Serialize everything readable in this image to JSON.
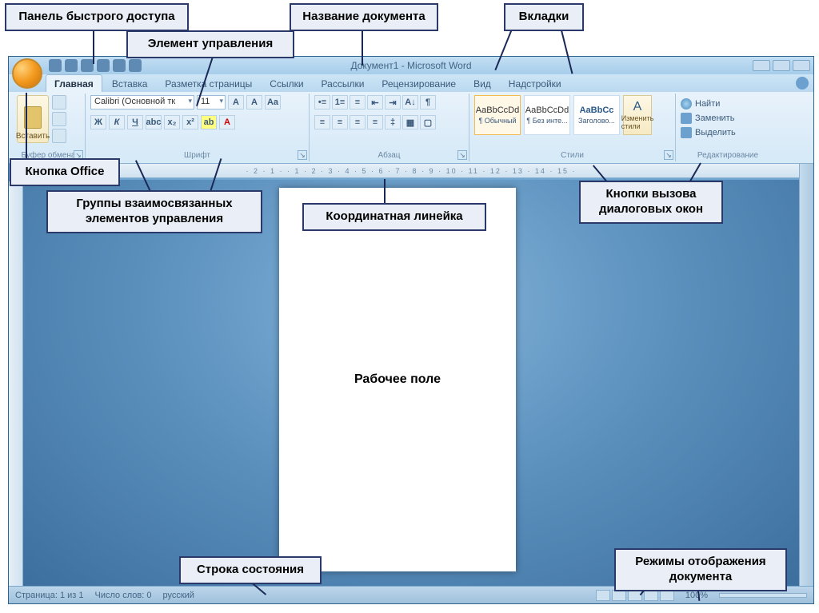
{
  "callouts": {
    "quick_access": "Панель быстрого доступа",
    "control_element": "Элемент управления",
    "document_title": "Название документа",
    "tabs": "Вкладки",
    "office_button": "Кнопка Office",
    "groups": "Группы взаимосвязанных элементов управления",
    "ruler": "Координатная линейка",
    "dialog_launchers": "Кнопки вызова диалоговых окон",
    "workspace": "Рабочее поле",
    "status_bar": "Строка состояния",
    "view_modes": "Режимы отображения документа"
  },
  "title": "Документ1 - Microsoft Word",
  "tabs_list": {
    "home": "Главная",
    "insert": "Вставка",
    "layout": "Разметка страницы",
    "refs": "Ссылки",
    "mail": "Рассылки",
    "review": "Рецензирование",
    "view": "Вид",
    "addins": "Надстройки"
  },
  "ribbon": {
    "clipboard": {
      "label": "Буфер обмена",
      "paste": "Вставить"
    },
    "font": {
      "label": "Шрифт",
      "font_name": "Calibri (Основной тк",
      "font_size": "11"
    },
    "paragraph": {
      "label": "Абзац"
    },
    "styles": {
      "label": "Стили",
      "preview": "AaBbCcDd",
      "preview_big": "AaBbCc",
      "normal": "¶ Обычный",
      "no_spacing": "¶ Без инте...",
      "heading1": "Заголово...",
      "change": "Изменить стили"
    },
    "editing": {
      "label": "Редактирование",
      "find": "Найти",
      "replace": "Заменить",
      "select": "Выделить"
    }
  },
  "ruler_text": "· 2 · 1 ·   · 1 · 2 · 3 · 4 · 5 · 6 · 7 · 8 · 9 · 10 · 11 · 12 · 13 · 14 · 15 ·",
  "status": {
    "page": "Страница: 1 из 1",
    "words": "Число слов: 0",
    "lang": "русский",
    "zoom": "100%"
  }
}
